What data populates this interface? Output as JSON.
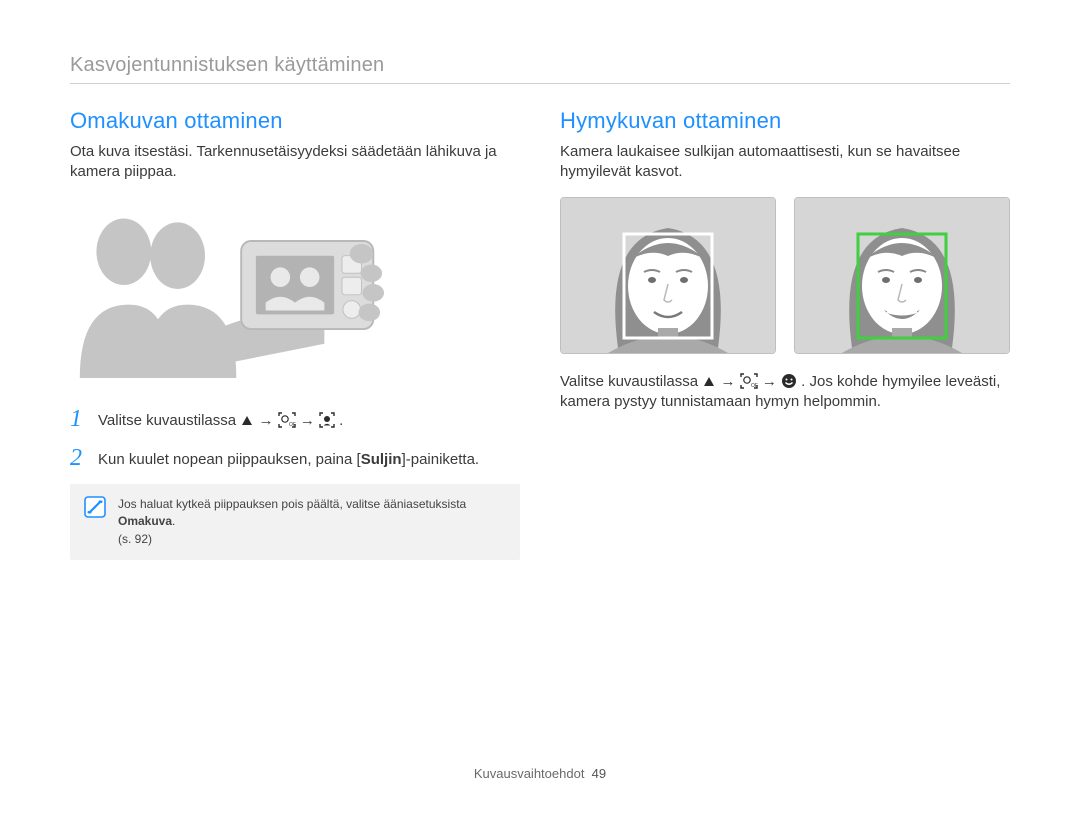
{
  "header": {
    "title": "Kasvojentunnistuksen käyttäminen"
  },
  "left": {
    "title": "Omakuvan ottaminen",
    "intro": "Ota kuva itsestäsi. Tarkennusetäisyydeksi säädetään lähikuva ja kamera piippaa.",
    "step1_prefix": "Valitse kuvaustilassa ",
    "arrow": " → ",
    "period": ".",
    "step2_a": "Kun kuulet nopean piippauksen, paina [",
    "step2_b": "Suljin",
    "step2_c": "]-painiketta.",
    "note_a": "Jos haluat kytkeä piippauksen pois päältä, valitse ääniasetuksista ",
    "note_b": "Omakuva",
    "note_c": ".",
    "note_ref": "(s. 92)"
  },
  "right": {
    "title": "Hymykuvan ottaminen",
    "intro": "Kamera laukaisee sulkijan automaattisesti, kun se havaitsee hymyilevät kasvot.",
    "line_a": "Valitse kuvaustilassa ",
    "arrow": " → ",
    "line_b": ". Jos kohde hymyilee leveästi, kamera pystyy tunnistamaan hymyn helpommin."
  },
  "footer": {
    "label": "Kuvausvaihtoehdot",
    "page": "49"
  }
}
